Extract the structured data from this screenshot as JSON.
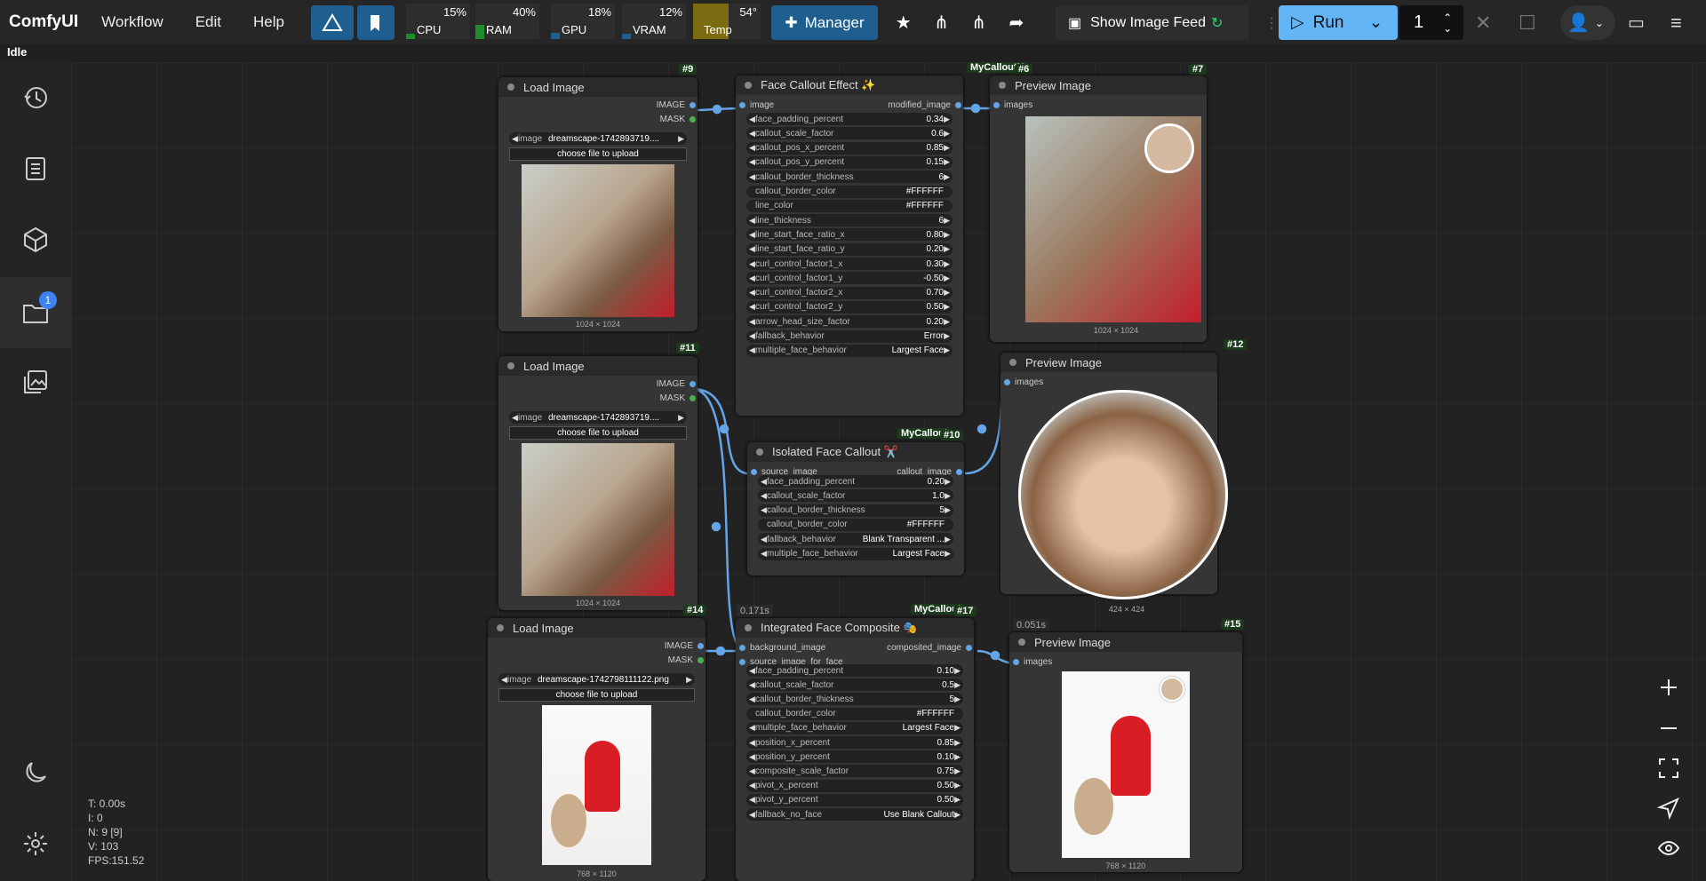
{
  "app": {
    "name": "ComfyUI",
    "menus": [
      "Workflow",
      "Edit",
      "Help"
    ],
    "status": "Idle"
  },
  "monitors": [
    {
      "name": "CPU",
      "value": "15%",
      "level": 0.15,
      "color": "#1c8f2c"
    },
    {
      "name": "RAM",
      "value": "40%",
      "level": 0.4,
      "color": "#1c8f2c"
    },
    {
      "name": "GPU",
      "value": "18%",
      "level": 0.18,
      "color": "#1f5f8f"
    },
    {
      "name": "VRAM",
      "value": "12%",
      "level": 0.12,
      "color": "#1f5f8f"
    },
    {
      "name": "Temp",
      "value": "54°",
      "level": 1,
      "color": "#8f7a0a"
    }
  ],
  "toolbar": {
    "manager": "Manager",
    "feed": "Show Image Feed",
    "run": "Run",
    "queue_count": "1"
  },
  "sidebar": {
    "badge": "1"
  },
  "stats": [
    "T: 0.00s",
    "I: 0",
    "N: 9 [9]",
    "V: 103",
    "FPS:151.52"
  ],
  "nodes": {
    "n9": {
      "id": "#9",
      "title": "Load Image",
      "out1": "IMAGE",
      "out2": "MASK",
      "image_label": "image",
      "image_value": "dreamscape-1742893719....",
      "upload": "choose file to upload",
      "dim": "1024 × 1024"
    },
    "n11": {
      "id": "#11",
      "title": "Load Image",
      "out1": "IMAGE",
      "out2": "MASK",
      "image_label": "image",
      "image_value": "dreamscape-1742893719....",
      "upload": "choose file to upload",
      "dim": "1024 × 1024"
    },
    "n14": {
      "id": "#14",
      "title": "Load Image",
      "out1": "IMAGE",
      "out2": "MASK",
      "image_label": "image",
      "image_value": "dreamscape-1742798111122.png",
      "upload": "choose file to upload",
      "dim": "768 × 1120"
    },
    "n6": {
      "id": "#6",
      "tag": "MyCalloutN",
      "title": "Face Callout Effect ✨",
      "in": "image",
      "out": "modified_image",
      "widgets": [
        [
          "face_padding_percent",
          "0.34"
        ],
        [
          "callout_scale_factor",
          "0.6"
        ],
        [
          "callout_pos_x_percent",
          "0.85"
        ],
        [
          "callout_pos_y_percent",
          "0.15"
        ],
        [
          "callout_border_thickness",
          "6"
        ],
        [
          "callout_border_color",
          "#FFFFFF"
        ],
        [
          "line_color",
          "#FFFFFF"
        ],
        [
          "line_thickness",
          "6"
        ],
        [
          "line_start_face_ratio_x",
          "0.80"
        ],
        [
          "line_start_face_ratio_y",
          "0.20"
        ],
        [
          "curl_control_factor1_x",
          "0.30"
        ],
        [
          "curl_control_factor1_y",
          "-0.50"
        ],
        [
          "curl_control_factor2_x",
          "0.70"
        ],
        [
          "curl_control_factor2_y",
          "0.50"
        ],
        [
          "arrow_head_size_factor",
          "0.20"
        ],
        [
          "fallback_behavior",
          "Error"
        ],
        [
          "multiple_face_behavior",
          "Largest Face"
        ]
      ]
    },
    "n10": {
      "id": "#10",
      "tag": "MyCallout",
      "title": "Isolated Face Callout ✂️",
      "in": "source_image",
      "out": "callout_image",
      "widgets": [
        [
          "face_padding_percent",
          "0.20"
        ],
        [
          "callout_scale_factor",
          "1.0"
        ],
        [
          "callout_border_thickness",
          "5"
        ],
        [
          "callout_border_color",
          "#FFFFFF"
        ],
        [
          "fallback_behavior",
          "Blank Transparent ..."
        ],
        [
          "multiple_face_behavior",
          "Largest Face"
        ]
      ]
    },
    "n17": {
      "id": "#17",
      "tag": "MyCallout",
      "timing": "0.171s",
      "title": "Integrated Face Composite 🎭",
      "in1": "background_image",
      "in2": "source_image_for_face",
      "out": "composited_image",
      "widgets": [
        [
          "face_padding_percent",
          "0.10"
        ],
        [
          "callout_scale_factor",
          "0.5"
        ],
        [
          "callout_border_thickness",
          "5"
        ],
        [
          "callout_border_color",
          "#FFFFFF"
        ],
        [
          "multiple_face_behavior",
          "Largest Face"
        ],
        [
          "position_x_percent",
          "0.85"
        ],
        [
          "position_y_percent",
          "0.10"
        ],
        [
          "composite_scale_factor",
          "0.75"
        ],
        [
          "pivot_x_percent",
          "0.50"
        ],
        [
          "pivot_y_percent",
          "0.50"
        ],
        [
          "fallback_no_face",
          "Use Blank Callout"
        ]
      ]
    },
    "n7": {
      "id": "#7",
      "title": "Preview Image",
      "in": "images",
      "dim": "1024 × 1024"
    },
    "n12": {
      "id": "#12",
      "title": "Preview Image",
      "in": "images",
      "dim": "424 × 424"
    },
    "n15": {
      "id": "#15",
      "timing": "0.051s",
      "title": "Preview Image",
      "in": "images",
      "dim": "768 × 1120"
    }
  }
}
